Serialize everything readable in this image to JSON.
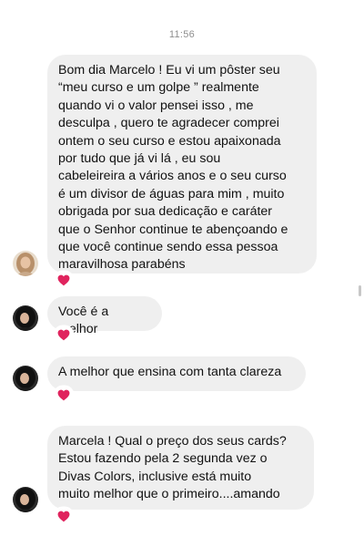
{
  "chat": {
    "timestamp": "11:56",
    "messages": [
      {
        "text": "Bom dia Marcelo ! Eu vi um pôster seu\n“meu curso e um golpe ” realmente\nquando vi o valor pensei isso , me\ndesculpa , quero te agradecer comprei\nontem o seu curso e estou apaixonada\npor tudo que já vi lá , eu sou\ncabeleireira a vários anos e o seu curso\né um divisor de águas para mim , muito\nobrigada por sua dedicação e caráter\nque o Senhor continue te abençoando e\nque você continue sendo essa pessoa\nmaravilhosa parabéns",
        "reaction": "heart",
        "avatar": "light-haired-woman"
      },
      {
        "text": "Você é a melhor",
        "reaction": "heart",
        "avatar": "dark-haired-woman"
      },
      {
        "text": "A melhor que ensina com tanta clareza",
        "reaction": "heart",
        "avatar": "dark-haired-woman"
      },
      {
        "text": "Marcela ! Qual o preço dos seus cards?\nEstou fazendo pela 2 segunda vez o\nDivas Colors,  inclusive está muito\nmuito melhor que o primeiro....amando",
        "reaction": "heart",
        "avatar": "dark-haired-woman"
      }
    ]
  },
  "colors": {
    "bubble": "#efefef",
    "heart": "#e0245e",
    "timestamp": "#8e8e8e"
  }
}
